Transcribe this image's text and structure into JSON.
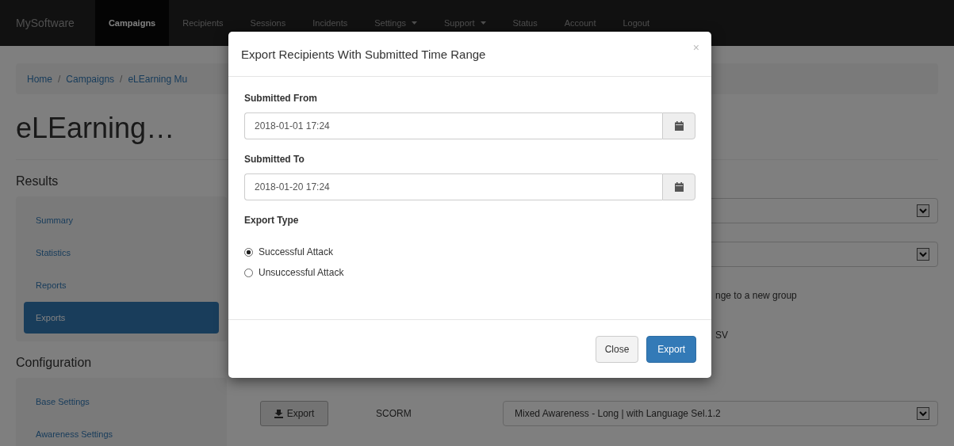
{
  "navbar": {
    "brand": "MySoftware",
    "items": [
      {
        "label": "Campaigns",
        "selected": true,
        "dropdown": false
      },
      {
        "label": "Recipients",
        "selected": false,
        "dropdown": false
      },
      {
        "label": "Sessions",
        "selected": false,
        "dropdown": false
      },
      {
        "label": "Incidents",
        "selected": false,
        "dropdown": false
      },
      {
        "label": "Settings",
        "selected": false,
        "dropdown": true
      },
      {
        "label": "Support",
        "selected": false,
        "dropdown": true
      },
      {
        "label": "Status",
        "selected": false,
        "dropdown": false
      },
      {
        "label": "Account",
        "selected": false,
        "dropdown": false
      },
      {
        "label": "Logout",
        "selected": false,
        "dropdown": false
      }
    ]
  },
  "breadcrumb": {
    "separator": "/",
    "items": [
      "Home",
      "Campaigns",
      "eLEarning Mu"
    ]
  },
  "page_title": "eLEarning…",
  "sidebar": {
    "sections": [
      {
        "heading": "Results",
        "items": [
          {
            "label": "Summary",
            "selected": false
          },
          {
            "label": "Statistics",
            "selected": false
          },
          {
            "label": "Reports",
            "selected": false
          },
          {
            "label": "Exports",
            "selected": true
          }
        ]
      },
      {
        "heading": "Configuration",
        "items": [
          {
            "label": "Base Settings",
            "selected": false
          },
          {
            "label": "Awareness Settings",
            "selected": false
          }
        ]
      }
    ]
  },
  "content": {
    "rows": [
      {
        "kind": "select"
      },
      {
        "kind": "select"
      },
      {
        "kind": "text",
        "text": "nge to a new group"
      },
      {
        "kind": "text",
        "text": "SV"
      },
      {
        "kind": "export",
        "button": "Export",
        "format": "SCORM",
        "select": "Mixed Awareness - Long | with Language Sel.1.2"
      }
    ]
  },
  "modal": {
    "title": "Export Recipients With Submitted Time Range",
    "close": "×",
    "fields": [
      {
        "label": "Submitted From",
        "value": "2018-01-01 17:24"
      },
      {
        "label": "Submitted To",
        "value": "2018-01-20 17:24"
      }
    ],
    "export_type": {
      "label": "Export Type",
      "options": [
        {
          "label": "Successful Attack",
          "selected": true
        },
        {
          "label": "Unsuccessful Attack",
          "selected": false
        }
      ]
    },
    "buttons": [
      {
        "label": "Close",
        "kind": "default"
      },
      {
        "label": "Export",
        "kind": "primary"
      }
    ]
  }
}
